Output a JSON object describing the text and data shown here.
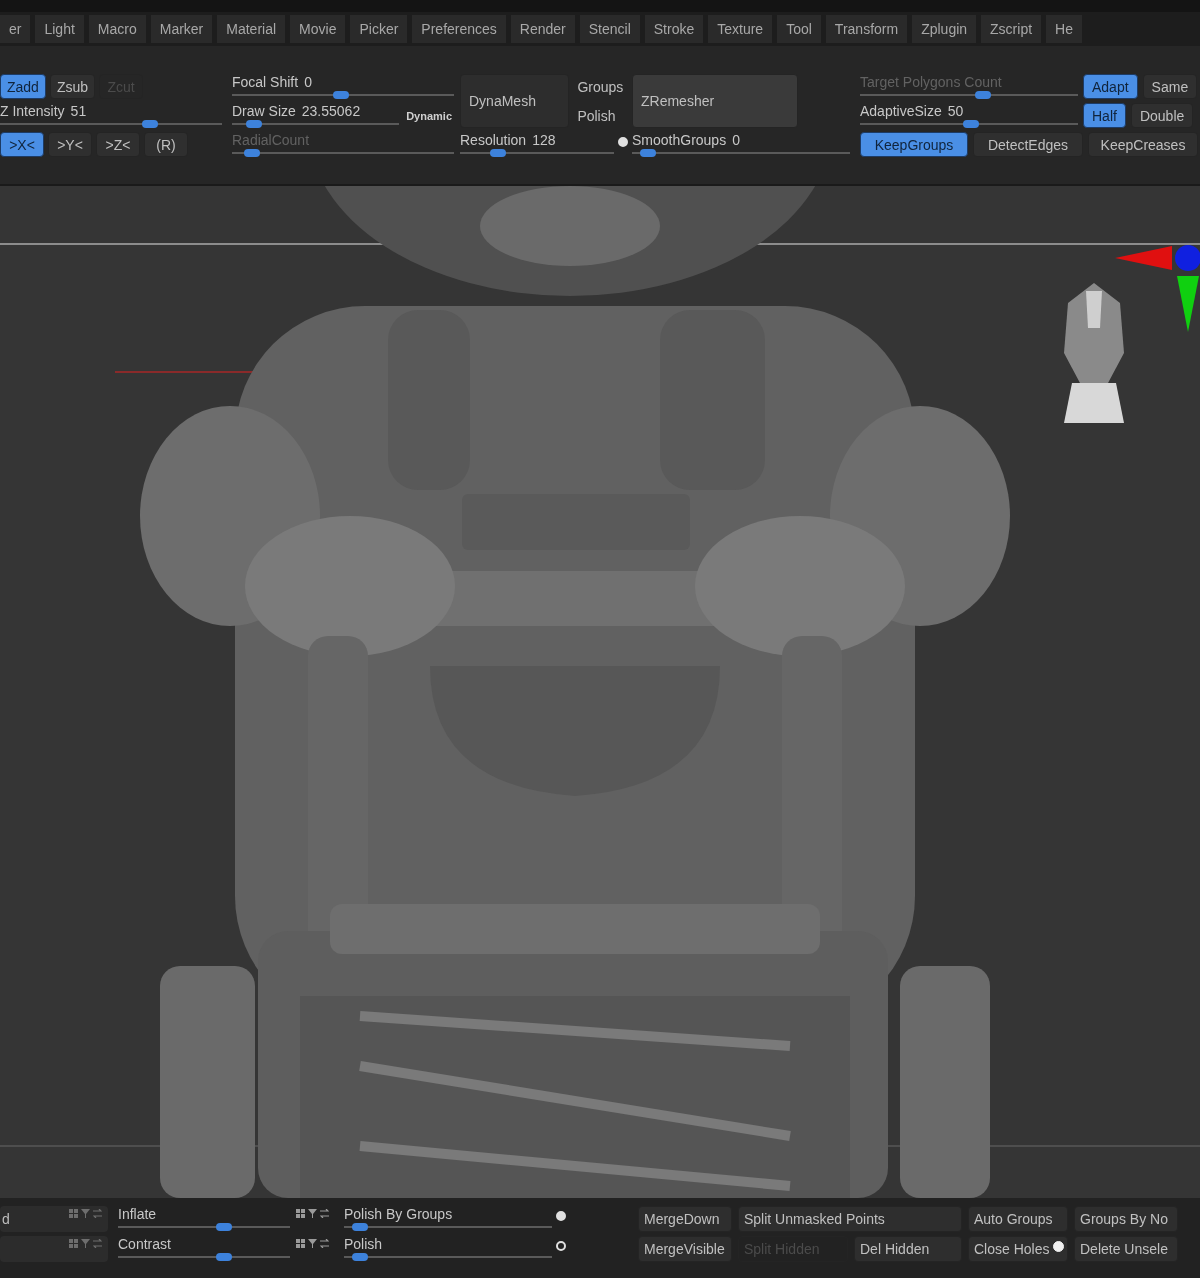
{
  "menu": [
    {
      "label": "er"
    },
    {
      "label": "Light"
    },
    {
      "label": "Macro"
    },
    {
      "label": "Marker"
    },
    {
      "label": "Material"
    },
    {
      "label": "Movie"
    },
    {
      "label": "Picker"
    },
    {
      "label": "Preferences"
    },
    {
      "label": "Render"
    },
    {
      "label": "Stencil"
    },
    {
      "label": "Stroke"
    },
    {
      "label": "Texture"
    },
    {
      "label": "Tool"
    },
    {
      "label": "Transform"
    },
    {
      "label": "Zplugin"
    },
    {
      "label": "Zscript"
    },
    {
      "label": "He"
    }
  ],
  "toolbar": {
    "columns": [
      {
        "rows": [
          [
            {
              "kind": "button",
              "label": "Zadd",
              "selected": true,
              "disabled": false
            },
            {
              "kind": "button",
              "label": "Zsub",
              "selected": false,
              "disabled": false
            },
            {
              "kind": "button",
              "label": "Zcut",
              "selected": false,
              "disabled": true
            }
          ],
          [
            {
              "kind": "slider",
              "label": "Z Intensity",
              "value": "51",
              "level": 0.69,
              "disabled": false
            }
          ],
          [
            {
              "kind": "button",
              "label": ">X<",
              "selected": true,
              "disabled": false
            },
            {
              "kind": "button",
              "label": ">Y<",
              "selected": false,
              "disabled": false
            },
            {
              "kind": "button",
              "label": ">Z<",
              "selected": false,
              "disabled": false
            },
            {
              "kind": "button",
              "label": "(R)",
              "selected": false,
              "disabled": false
            }
          ]
        ]
      },
      {
        "rows": [
          [
            {
              "kind": "slider",
              "label": "Focal Shift",
              "value": "0",
              "level": 0.49,
              "disabled": false
            }
          ],
          [
            {
              "kind": "slider",
              "label": "Draw Size",
              "value": "23.55062",
              "level": 0.09,
              "disabled": false
            },
            {
              "kind": "small-button",
              "label": "Dynamic"
            }
          ],
          [
            {
              "kind": "slider",
              "label": "RadialCount",
              "level": 0.06,
              "disabled": true
            }
          ]
        ]
      },
      {
        "rows": [
          [
            {
              "kind": "large-button",
              "label": "DynaMesh"
            },
            {
              "kind": "stack",
              "items": [
                {
                  "kind": "button",
                  "label": "Groups",
                  "selected": false,
                  "disabled": false
                },
                {
                  "kind": "button",
                  "label": "Polish",
                  "selected": false,
                  "disabled": false
                }
              ]
            }
          ],
          [
            {
              "kind": "slider",
              "label": "Resolution",
              "value": "128",
              "level": 0.22,
              "disabled": false,
              "switch": {
                "on": true
              }
            }
          ]
        ]
      },
      {
        "rows": [
          [
            {
              "kind": "large-button",
              "label": "ZRemesher"
            }
          ],
          [
            {
              "kind": "slider",
              "label": "SmoothGroups",
              "value": "0",
              "level": 0.04,
              "disabled": false
            }
          ]
        ]
      },
      {
        "rows": [
          [
            {
              "kind": "slider",
              "label": "Target Polygons Count",
              "level": 0.57,
              "disabled": true
            },
            {
              "kind": "button",
              "label": "Adapt",
              "selected": true,
              "disabled": false
            },
            {
              "kind": "button",
              "label": "Same",
              "selected": false,
              "disabled": false
            }
          ],
          [
            {
              "kind": "slider",
              "label": "AdaptiveSize",
              "value": "50",
              "level": 0.51,
              "disabled": false
            },
            {
              "kind": "button",
              "label": "Half",
              "selected": true,
              "disabled": false
            },
            {
              "kind": "button",
              "label": "Double",
              "selected": false,
              "disabled": false
            }
          ],
          [
            {
              "kind": "button",
              "label": "KeepGroups",
              "selected": true,
              "disabled": false
            },
            {
              "kind": "button",
              "label": "DetectEdges",
              "selected": false,
              "disabled": false
            },
            {
              "kind": "button",
              "label": "KeepCreases",
              "selected": false,
              "disabled": false
            }
          ]
        ]
      }
    ]
  },
  "bottom_panel": {
    "rows": [
      {
        "field": {
          "value": "d"
        },
        "sliders": [
          {
            "label": "Inflate",
            "level": 0.63
          },
          {
            "label": "Polish By Groups",
            "level": 0.04,
            "switch": {
              "on": true
            }
          }
        ],
        "buttons": [
          {
            "label": "MergeDown",
            "disabled": false
          },
          {
            "label": "Split Unmasked Points",
            "disabled": false
          },
          {
            "label": "Auto Groups",
            "disabled": false
          },
          {
            "label": "Groups By No",
            "disabled": false
          }
        ]
      },
      {
        "field": {},
        "sliders": [
          {
            "label": "Contrast",
            "level": 0.63
          },
          {
            "label": "Polish",
            "level": 0.04,
            "switch": {
              "on": false
            }
          }
        ],
        "buttons": [
          {
            "label": "MergeVisible",
            "disabled": false
          },
          {
            "label": "Split Hidden",
            "disabled": true
          },
          {
            "label": "Del Hidden",
            "disabled": false
          },
          {
            "label": "Close Holes",
            "disabled": false,
            "switch": {
              "on": true
            }
          },
          {
            "label": "Delete Unsele",
            "disabled": false
          }
        ]
      }
    ]
  }
}
